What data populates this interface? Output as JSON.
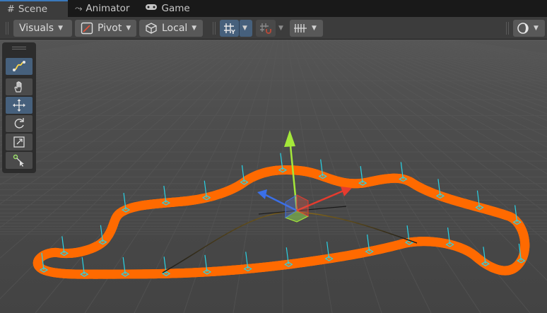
{
  "tabs": [
    {
      "label": "Scene",
      "icon": "grid-icon",
      "active": true
    },
    {
      "label": "Animator",
      "icon": "animator-icon",
      "active": false
    },
    {
      "label": "Game",
      "icon": "gamepad-icon",
      "active": false
    }
  ],
  "toolbar": {
    "visuals_label": "Visuals",
    "pivot_label": "Pivot",
    "local_label": "Local"
  },
  "tools": [
    {
      "name": "spline-tool",
      "icon": "spline-icon",
      "active": true
    },
    {
      "name": "hand-tool",
      "icon": "hand-icon",
      "active": false
    },
    {
      "name": "move-tool",
      "icon": "move-arrows-icon",
      "active": true
    },
    {
      "name": "rotate-tool",
      "icon": "rotate-icon",
      "active": false
    },
    {
      "name": "scale-tool",
      "icon": "scale-icon",
      "active": false
    },
    {
      "name": "custom-tool",
      "icon": "custom-tool-icon",
      "active": false
    }
  ],
  "colors": {
    "road_outline": "#ff6a00",
    "road_fill": "#1e1e1e",
    "knot": "#29d3e6",
    "gizmo_y": "#a4e83a",
    "gizmo_x": "#e63b2e",
    "gizmo_z": "#3a6fe8"
  }
}
